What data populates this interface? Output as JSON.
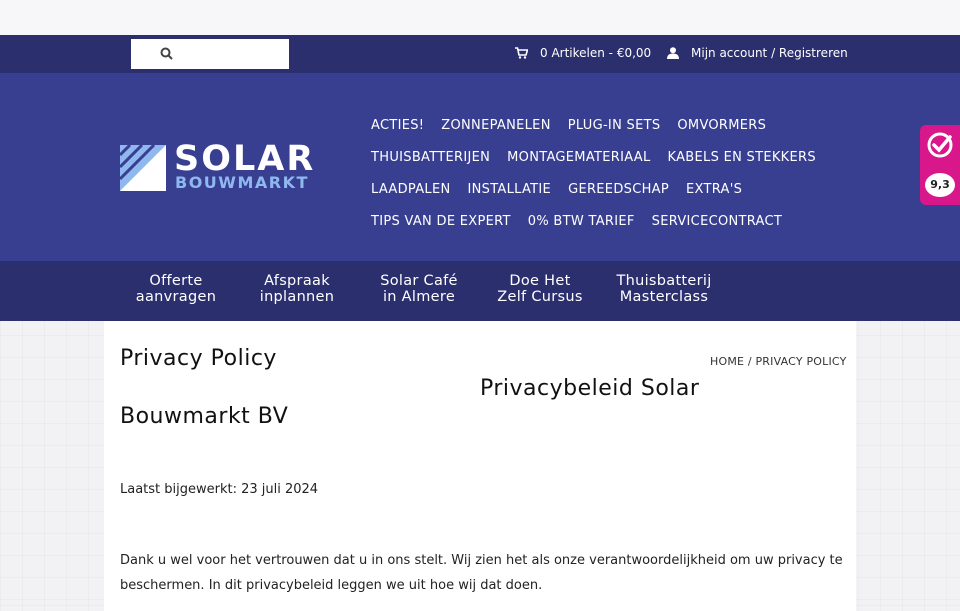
{
  "search": {
    "placeholder": ""
  },
  "topbar": {
    "cart_label": "0 Artikelen - €0,00",
    "account_label": "Mijn account / Registreren"
  },
  "logo": {
    "line1": "SOLAR",
    "line2": "BOUWMARKT"
  },
  "nav": {
    "rows": [
      [
        "ACTIES!",
        "ZONNEPANELEN",
        "PLUG-IN SETS",
        "OMVORMERS"
      ],
      [
        "THUISBATTERIJEN",
        "MONTAGEMATERIAAL",
        "KABELS EN STEKKERS"
      ],
      [
        "LAADPALEN",
        "INSTALLATIE",
        "GEREEDSCHAP",
        "EXTRA'S"
      ],
      [
        "TIPS VAN DE EXPERT",
        "0% BTW TARIEF",
        "SERVICECONTRACT"
      ]
    ]
  },
  "subnav": {
    "items": [
      {
        "l1": "Offerte",
        "l2": "aanvragen"
      },
      {
        "l1": "Afspraak",
        "l2": "inplannen"
      },
      {
        "l1": "Solar Café",
        "l2": "in Almere"
      },
      {
        "l1": "Doe Het",
        "l2": "Zelf Cursus"
      },
      {
        "l1": "Thuisbatterij",
        "l2": "Masterclass"
      }
    ]
  },
  "rating": {
    "score": "9,3"
  },
  "page": {
    "title": "Privacy Policy",
    "breadcrumb": "HOME / PRIVACY POLICY",
    "heading_part1": "Privacybeleid Solar",
    "heading_part2": "Bouwmarkt BV",
    "updated": "Laatst bijgewerkt: 23 juli 2024",
    "paragraph": "Dank u wel voor het vertrouwen dat u in ons stelt.  Wij zien het als onze verantwoordelijkheid om uw privacy te beschermen. In dit privacybeleid leggen we uit hoe wij dat doen."
  },
  "colors": {
    "header_bg": "#383f91",
    "topbar_bg": "#2b2f6e",
    "accent_pink": "#d8178a",
    "logo_blue": "#8fb8ee"
  },
  "icons": {
    "search": "search-icon",
    "cart": "cart-icon",
    "account": "user-icon",
    "rating": "checkmark-badge-icon"
  }
}
